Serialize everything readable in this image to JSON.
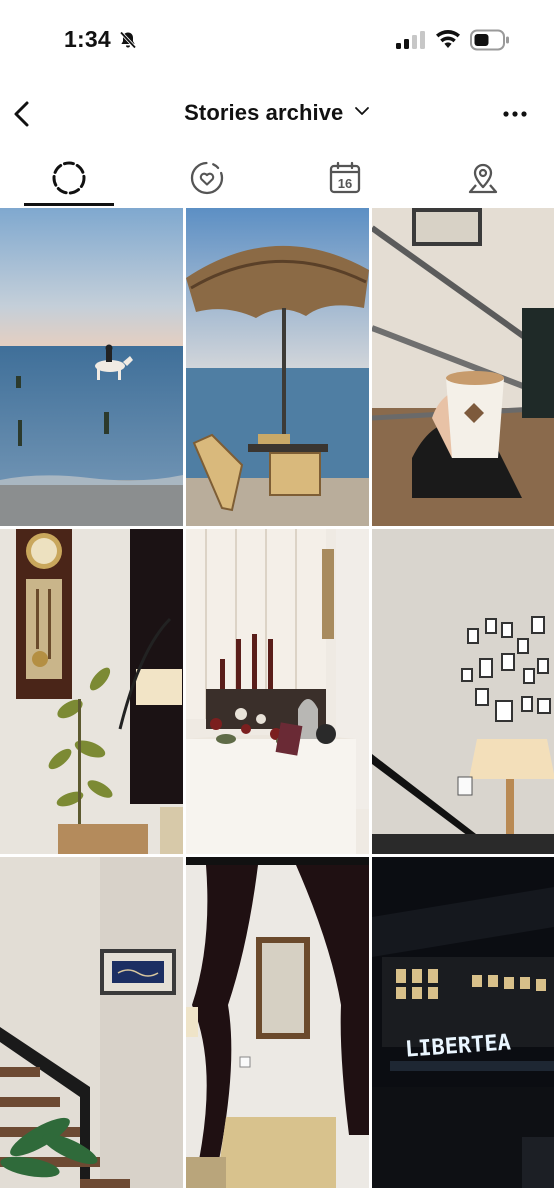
{
  "status_bar": {
    "time": "1:34",
    "icons": [
      "bell-slash-icon",
      "cellular-signal-icon",
      "wifi-icon",
      "battery-icon"
    ]
  },
  "header": {
    "title": "Stories archive",
    "back_icon": "chevron-left-icon",
    "dropdown_icon": "chevron-down-icon",
    "more_icon": "more-horizontal-icon"
  },
  "tabs": [
    {
      "name": "stories",
      "icon": "dashed-circle-icon",
      "selected": true
    },
    {
      "name": "highlights",
      "icon": "heart-circle-icon",
      "selected": false
    },
    {
      "name": "calendar",
      "icon": "calendar-icon",
      "calendar_day": "16",
      "selected": false
    },
    {
      "name": "map",
      "icon": "map-pin-icon",
      "selected": false
    }
  ],
  "grid": {
    "columns": 3,
    "tiles": [
      {
        "subject": "beach-horse-rider"
      },
      {
        "subject": "beach-umbrella-chairs"
      },
      {
        "subject": "coffee-cup-in-hand"
      },
      {
        "subject": "wall-clock-lamp-plant"
      },
      {
        "subject": "candles-table-decor"
      },
      {
        "subject": "gallery-wall-lamp"
      },
      {
        "subject": "staircase-framed-art"
      },
      {
        "subject": "curtain-mirror-wall"
      },
      {
        "subject": "libertea-night-sign",
        "sign_text": "LIBERTEA"
      }
    ]
  },
  "colors": {
    "text": "#111111",
    "background": "#ffffff",
    "indicator": "#111111"
  }
}
